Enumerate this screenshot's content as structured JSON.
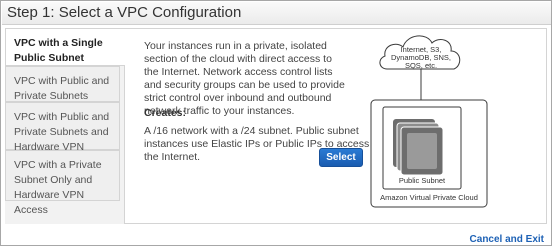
{
  "header": {
    "title": "Step 1: Select a VPC Configuration"
  },
  "tabs": [
    {
      "label": "VPC with a Single Public Subnet",
      "active": true
    },
    {
      "label": "VPC with Public and Private Subnets",
      "active": false
    },
    {
      "label": "VPC with Public and Private Subnets and Hardware VPN Access",
      "active": false
    },
    {
      "label": "VPC with a Private Subnet Only and Hardware VPN Access",
      "active": false
    }
  ],
  "content": {
    "description": "Your instances run in a private, isolated section of the cloud with direct access to the Internet. Network access control lists and security groups can be used to provide strict control over inbound and outbound network traffic to your instances.",
    "creates_heading": "Creates:",
    "creates_text": "A /16 network with a /24 subnet. Public subnet instances use Elastic IPs or Public IPs to access the Internet.",
    "select_button": "Select"
  },
  "diagram": {
    "cloud_lines": [
      "Internet, S3,",
      "DynamoDB, SNS,",
      "SQS, etc."
    ],
    "subnet_label": "Public Subnet",
    "vpc_label": "Amazon Virtual Private Cloud",
    "colors": {
      "instance_dark": "#6d6d6d",
      "instance_light": "#9a9a9a",
      "outline": "#3b3b3b"
    }
  },
  "footer": {
    "cancel_label": "Cancel and Exit"
  },
  "colors": {
    "link_blue": "#1d61b5",
    "button_blue": "#1a5cb0",
    "tab_gray": "#efefef"
  }
}
